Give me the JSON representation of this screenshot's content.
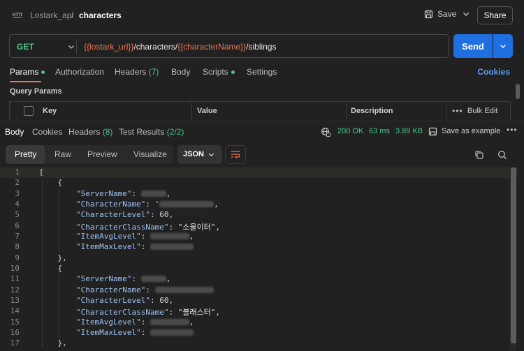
{
  "header": {
    "collection": "Lostark_api",
    "separator": "/",
    "request": "characters",
    "save_label": "Save",
    "share_label": "Share"
  },
  "request": {
    "method": "GET",
    "url_parts": [
      {
        "text": "{{lostark_url}}",
        "var": true
      },
      {
        "text": "/characters/",
        "var": false
      },
      {
        "text": "{{characterName}}",
        "var": true
      },
      {
        "text": "/siblings",
        "var": false
      }
    ],
    "send_label": "Send"
  },
  "request_tabs": {
    "params": "Params",
    "authorization": "Authorization",
    "headers": "Headers",
    "headers_count": "(7)",
    "body": "Body",
    "scripts": "Scripts",
    "settings": "Settings",
    "cookies": "Cookies"
  },
  "query_params": {
    "title": "Query Params",
    "columns": [
      "Key",
      "Value",
      "Description"
    ],
    "bulk_edit": "Bulk Edit"
  },
  "response": {
    "tabs": {
      "body": "Body",
      "cookies": "Cookies",
      "headers": "Headers",
      "headers_count": "(8)",
      "tests": "Test Results",
      "tests_count": "(2/2)"
    },
    "status": "200 OK",
    "time": "63 ms",
    "size": "3.89 KB",
    "save_example": "Save as example",
    "view_tabs": [
      "Pretty",
      "Raw",
      "Preview",
      "Visualize"
    ],
    "format": "JSON"
  },
  "code": {
    "line_numbers": [
      "1",
      "2",
      "3",
      "4",
      "5",
      "6",
      "7",
      "8",
      "9",
      "10",
      "11",
      "12",
      "13",
      "14",
      "15",
      "16",
      "17"
    ],
    "class_1": "\"소울이터\"",
    "class_2": "\"블래스터\"",
    "level_1": "60",
    "level_2": "60"
  },
  "colors": {
    "accent": "#f0734f",
    "send": "#1e6fe0",
    "success": "#4cc38a",
    "link": "#5a9cf8"
  }
}
